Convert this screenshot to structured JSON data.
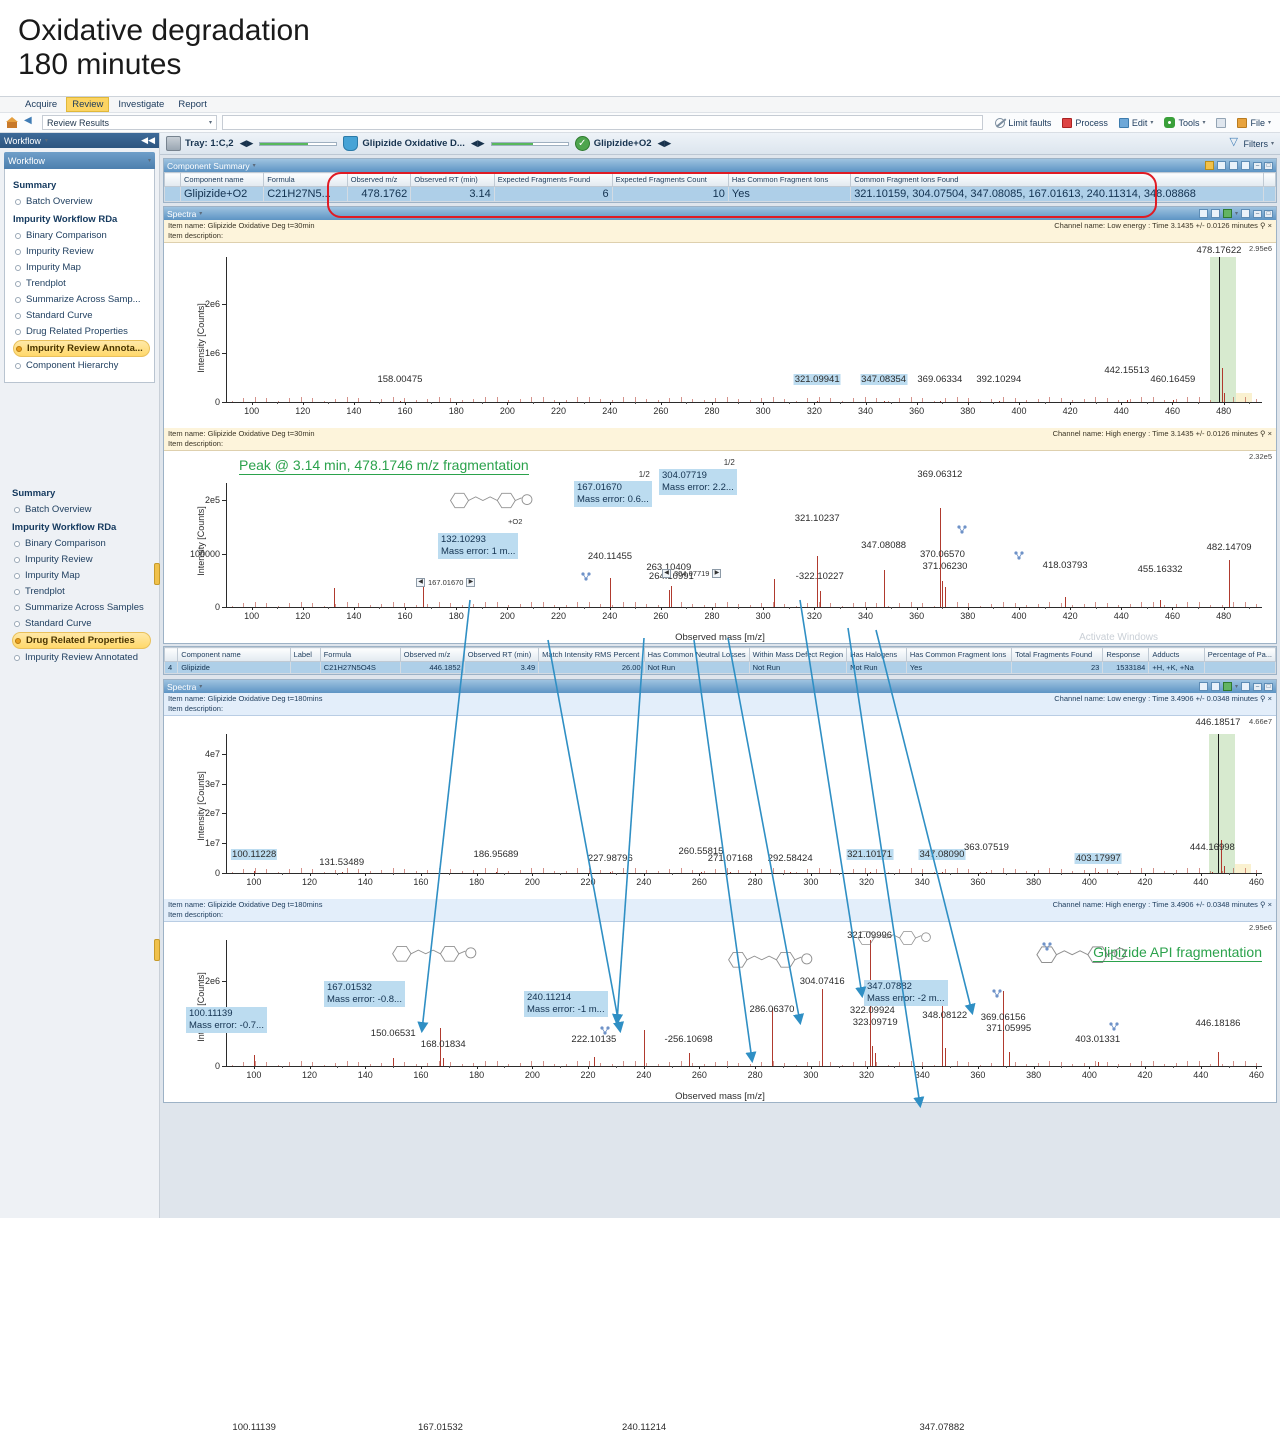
{
  "slide": {
    "title": "Oxidative degradation\n180 minutes"
  },
  "menubar": {
    "items": [
      "Acquire",
      "Review",
      "Investigate",
      "Report"
    ],
    "active": "Review"
  },
  "addressbar": {
    "breadcrumb": "Review Results",
    "buttons": [
      {
        "label": "Limit faults",
        "icon": "limit-faults-icon"
      },
      {
        "label": "Process",
        "icon": "process-icon"
      },
      {
        "label": "Edit",
        "icon": "edit-icon"
      },
      {
        "label": "Tools",
        "icon": "tools-gear-icon"
      },
      {
        "label": "File",
        "icon": "file-folder-icon"
      }
    ]
  },
  "sidebar": {
    "header": "Workflow",
    "subheader": "Workflow",
    "top_panel": {
      "groups": [
        {
          "title": "Summary",
          "items": [
            "Batch Overview"
          ]
        },
        {
          "title": "Impurity Workflow RDa",
          "items": [
            "Binary Comparison",
            "Impurity Review",
            "Impurity Map",
            "Trendplot",
            "Summarize Across Samp...",
            "Standard Curve",
            "Drug Related Properties",
            "Impurity Review Annota...",
            "Component Hierarchy"
          ]
        }
      ],
      "selected": "Impurity Review Annota..."
    },
    "bottom_panel": {
      "groups": [
        {
          "title": "Summary",
          "items": [
            "Batch Overview"
          ]
        },
        {
          "title": "Impurity Workflow RDa",
          "items": [
            "Binary Comparison",
            "Impurity Review",
            "Impurity Map",
            "Trendplot",
            "Summarize Across Samples",
            "Standard Curve",
            "Drug Related Properties",
            "Impurity Review Annotated"
          ]
        }
      ],
      "selected": "Drug Related Properties"
    }
  },
  "context_bar": {
    "tray": "Tray: 1:C,2",
    "sample": "Glipizide Oxidative D...",
    "component": "Glipizide+O2",
    "filters": "Filters"
  },
  "component_summary": {
    "panel_title": "Component Summary",
    "columns": [
      "Component name",
      "Formula",
      "Observed m/z",
      "Observed RT (min)",
      "Expected Fragments Found",
      "Expected Fragments Count",
      "Has Common Fragment Ions",
      "Common Fragment Ions Found"
    ],
    "row": [
      "Glipizide+O2",
      "C21H27N5...",
      "478.1762",
      "3.14",
      "6",
      "10",
      "Yes",
      "321.10159, 304.07504, 347.08085, 167.01613, 240.11314, 348.08868"
    ],
    "highlight_color": "#e01b24"
  },
  "second_grid": {
    "columns": [
      "Component name",
      "Label",
      "Formula",
      "Observed m/z",
      "Observed RT (min)",
      "Match Intensity RMS Percent",
      "Has Common Neutral Losses",
      "Within Mass Defect Region",
      "Has Halogens",
      "Has Common Fragment Ions",
      "Total Fragments Found",
      "Response",
      "Adducts",
      "Percentage of Pa..."
    ],
    "row_index": "4",
    "row": [
      "Glipizide",
      "",
      "C21H27N5O4S",
      "446.1852",
      "3.49",
      "26.00",
      "Not Run",
      "Not Run",
      "Not Run",
      "Yes",
      "23",
      "1533184",
      "+H, +K, +Na",
      ""
    ]
  },
  "spectra_panels": [
    {
      "panel_title": "Spectra",
      "item_name": "Item name: Glipizide Oxidative Deg t=30min",
      "item_description": "Item description:",
      "channel": "Channel name: Low energy : Time 3.1435 +/- 0.0126 minutes"
    },
    {
      "item_name": "Item name: Glipizide Oxidative Deg t=30min",
      "item_description": "Item description:",
      "channel": "Channel name: High energy : Time 3.1435 +/- 0.0126 minutes"
    },
    {
      "panel_title": "Spectra",
      "item_name": "Item name: Glipizide Oxidative Deg t=180mins",
      "item_description": "Item description:",
      "channel": "Channel name: Low energy : Time 3.4906 +/- 0.0348 minutes"
    },
    {
      "item_name": "Item name: Glipizide Oxidative Deg t=180mins",
      "item_description": "Item description:",
      "channel": "Channel name: High energy : Time 3.4906 +/- 0.0348 minutes"
    }
  ],
  "annotations": {
    "peak_fragmentation_note": "Peak @ 3.14 min, 478.1746 m/z fragmentation",
    "api_fragmentation_note": "Glipizide API fragmentation",
    "watermark": "Activate Windows",
    "plus_o2": "+O2"
  },
  "chart_data": [
    {
      "type": "bar",
      "title": "Low energy spectrum, Glipizide Oxidative Deg t=30min",
      "xlabel": "",
      "ylabel": "Intensity [Counts]",
      "xlim": [
        90,
        495
      ],
      "ylim": [
        0,
        2950000
      ],
      "yticks": [
        0,
        1000000,
        2000000
      ],
      "ytick_labels": [
        "0",
        "1e6",
        "2e6"
      ],
      "xticks": [
        100,
        120,
        140,
        160,
        180,
        200,
        220,
        240,
        260,
        280,
        300,
        320,
        340,
        360,
        380,
        400,
        420,
        440,
        460,
        480
      ],
      "top_right_scale": "2.95e6",
      "peaks": [
        {
          "mz": 158.00475,
          "intensity": 30000,
          "label": "158.00475"
        },
        {
          "mz": 321.09941,
          "intensity": 25000,
          "label": "321.09941",
          "highlight": "blue"
        },
        {
          "mz": 347.08354,
          "intensity": 25000,
          "label": "347.08354",
          "highlight": "blue"
        },
        {
          "mz": 369.06334,
          "intensity": 22000,
          "label": "369.06334"
        },
        {
          "mz": 392.10294,
          "intensity": 20000,
          "label": "392.10294"
        },
        {
          "mz": 442.15513,
          "intensity": 40000,
          "label": "442.15513"
        },
        {
          "mz": 460.16459,
          "intensity": 35000,
          "label": "460.16459"
        },
        {
          "mz": 478.17622,
          "intensity": 2950000,
          "label": "478.17622",
          "highlight": "green"
        },
        {
          "mz": 479.178,
          "intensity": 700000
        },
        {
          "mz": 480.179,
          "intensity": 180000
        }
      ]
    },
    {
      "type": "bar",
      "title": "High energy spectrum, Glipizide Oxidative Deg t=30min",
      "xlabel": "Observed mass [m/z]",
      "ylabel": "Intensity [Counts]",
      "xlim": [
        90,
        495
      ],
      "ylim": [
        0,
        232000
      ],
      "yticks": [
        0,
        100000,
        200000
      ],
      "ytick_labels": [
        "0",
        "100000",
        "2e5"
      ],
      "xticks": [
        100,
        120,
        140,
        160,
        180,
        200,
        220,
        240,
        260,
        280,
        300,
        320,
        340,
        360,
        380,
        400,
        420,
        440,
        460,
        480
      ],
      "top_right_scale": "2.32e5",
      "peaks": [
        {
          "mz": 132.10293,
          "intensity": 35000,
          "label": "132.10293"
        },
        {
          "mz": 167.0167,
          "intensity": 45000,
          "label": "167.01670"
        },
        {
          "mz": 240.11455,
          "intensity": 55000,
          "label": "240.11455"
        },
        {
          "mz": 263.10409,
          "intensity": 32000,
          "label": "263.10409"
        },
        {
          "mz": 264.10991,
          "intensity": 40000,
          "label": "264.10991"
        },
        {
          "mz": 304.07719,
          "intensity": 52000,
          "label": "304.07719"
        },
        {
          "mz": 321.10237,
          "intensity": 95000,
          "label": "321.10237"
        },
        {
          "mz": 322.10227,
          "intensity": 30000,
          "label": "-322.10227"
        },
        {
          "mz": 347.08088,
          "intensity": 70000,
          "label": "347.08088"
        },
        {
          "mz": 369.06312,
          "intensity": 185000,
          "label": "369.06312"
        },
        {
          "mz": 370.0657,
          "intensity": 48000,
          "label": "370.06570"
        },
        {
          "mz": 371.0623,
          "intensity": 38000,
          "label": "371.06230"
        },
        {
          "mz": 418.03793,
          "intensity": 18000,
          "label": "418.03793"
        },
        {
          "mz": 455.16332,
          "intensity": 14000,
          "label": "455.16332"
        },
        {
          "mz": 482.14709,
          "intensity": 88000,
          "label": "482.14709"
        }
      ],
      "annotation_boxes": [
        {
          "mz": 132.10293,
          "line1": "132.10293",
          "line2": "Mass error: 1 m..."
        },
        {
          "mz": 167.0167,
          "line1": "167.01670",
          "line2": "Mass error: 0.6...",
          "badge": "1/2"
        },
        {
          "mz": 304.07719,
          "line1": "304.07719",
          "line2": "Mass error: 2.2...",
          "badge": "1/2"
        }
      ]
    },
    {
      "type": "bar",
      "title": "Low energy spectrum, Glipizide Oxidative Deg t=180mins",
      "xlabel": "",
      "ylabel": "Intensity [Counts]",
      "xlim": [
        90,
        462
      ],
      "ylim": [
        0,
        46600000
      ],
      "yticks": [
        0,
        10000000,
        20000000,
        30000000,
        40000000
      ],
      "ytick_labels": [
        "0",
        "1e7",
        "2e7",
        "3e7",
        "4e7"
      ],
      "xticks": [
        100,
        120,
        140,
        160,
        180,
        200,
        220,
        240,
        260,
        280,
        300,
        320,
        340,
        360,
        380,
        400,
        420,
        440,
        460
      ],
      "top_right_scale": "4.66e7",
      "peaks": [
        {
          "mz": 100.11228,
          "intensity": 700000,
          "label": "100.11228",
          "highlight": "blue"
        },
        {
          "mz": 131.53489,
          "intensity": 300000,
          "label": "131.53489"
        },
        {
          "mz": 186.95689,
          "intensity": 250000,
          "label": "186.95689"
        },
        {
          "mz": 227.98796,
          "intensity": 250000,
          "label": "227.98796"
        },
        {
          "mz": 260.55815,
          "intensity": 300000,
          "label": "260.55815"
        },
        {
          "mz": 271.07168,
          "intensity": 250000,
          "label": "271.07168"
        },
        {
          "mz": 292.58424,
          "intensity": 250000,
          "label": "292.58424"
        },
        {
          "mz": 321.10171,
          "intensity": 300000,
          "label": "321.10171",
          "highlight": "blue"
        },
        {
          "mz": 347.0809,
          "intensity": 300000,
          "label": "347.08090",
          "highlight": "blue"
        },
        {
          "mz": 363.07519,
          "intensity": 300000,
          "label": "363.07519"
        },
        {
          "mz": 403.17997,
          "intensity": 300000,
          "label": "403.17997",
          "highlight": "blue"
        },
        {
          "mz": 444.16998,
          "intensity": 500000,
          "label": "444.16998"
        },
        {
          "mz": 446.18517,
          "intensity": 46600000,
          "label": "446.18517",
          "highlight": "green"
        },
        {
          "mz": 447.187,
          "intensity": 11000000
        },
        {
          "mz": 448.189,
          "intensity": 2500000
        }
      ]
    },
    {
      "type": "bar",
      "title": "High energy spectrum, Glipizide Oxidative Deg t=180mins",
      "xlabel": "Observed mass [m/z]",
      "ylabel": "Intensity [Counts]",
      "xlim": [
        90,
        462
      ],
      "ylim": [
        0,
        2950000
      ],
      "yticks": [
        0,
        1000000,
        2000000
      ],
      "ytick_labels": [
        "0",
        "1e6",
        "2e6"
      ],
      "xticks": [
        100,
        120,
        140,
        160,
        180,
        200,
        220,
        240,
        260,
        280,
        300,
        320,
        340,
        360,
        380,
        400,
        420,
        440,
        460
      ],
      "top_right_scale": "2.95e6",
      "peaks": [
        {
          "mz": 100.11139,
          "intensity": 260000,
          "label": "100.11139"
        },
        {
          "mz": 150.06531,
          "intensity": 180000,
          "label": "150.06531"
        },
        {
          "mz": 167.01532,
          "intensity": 900000,
          "label": "167.01532"
        },
        {
          "mz": 168.01834,
          "intensity": 190000,
          "label": "168.01834"
        },
        {
          "mz": 222.10135,
          "intensity": 200000,
          "label": "222.10135"
        },
        {
          "mz": 240.11214,
          "intensity": 850000,
          "label": "240.11214"
        },
        {
          "mz": 256.10698,
          "intensity": 300000,
          "label": "-256.10698"
        },
        {
          "mz": 286.0637,
          "intensity": 1350000,
          "label": "286.06370"
        },
        {
          "mz": 304.07416,
          "intensity": 1800000,
          "label": "304.07416"
        },
        {
          "mz": 321.09996,
          "intensity": 2950000,
          "label": "321.09996"
        },
        {
          "mz": 322.09924,
          "intensity": 460000,
          "label": "322.09924"
        },
        {
          "mz": 323.09719,
          "intensity": 300000,
          "label": "323.09719"
        },
        {
          "mz": 347.07882,
          "intensity": 1600000,
          "label": "347.07882"
        },
        {
          "mz": 348.08122,
          "intensity": 420000,
          "label": "348.08122"
        },
        {
          "mz": 369.06156,
          "intensity": 1750000,
          "label": "369.06156"
        },
        {
          "mz": 371.05995,
          "intensity": 330000,
          "label": "371.05995"
        },
        {
          "mz": 403.01331,
          "intensity": 90000,
          "label": "403.01331"
        },
        {
          "mz": 446.18186,
          "intensity": 330000,
          "label": "446.18186"
        }
      ],
      "annotation_boxes": [
        {
          "mz": 100.11139,
          "line1": "100.11139",
          "line2": "Mass error: -0.7..."
        },
        {
          "mz": 167.01532,
          "line1": "167.01532",
          "line2": "Mass error: -0.8..."
        },
        {
          "mz": 240.11214,
          "line1": "240.11214",
          "line2": "Mass error: -1 m..."
        },
        {
          "mz": 347.07882,
          "line1": "347.07882",
          "line2": "Mass error: -2 m..."
        }
      ]
    }
  ]
}
